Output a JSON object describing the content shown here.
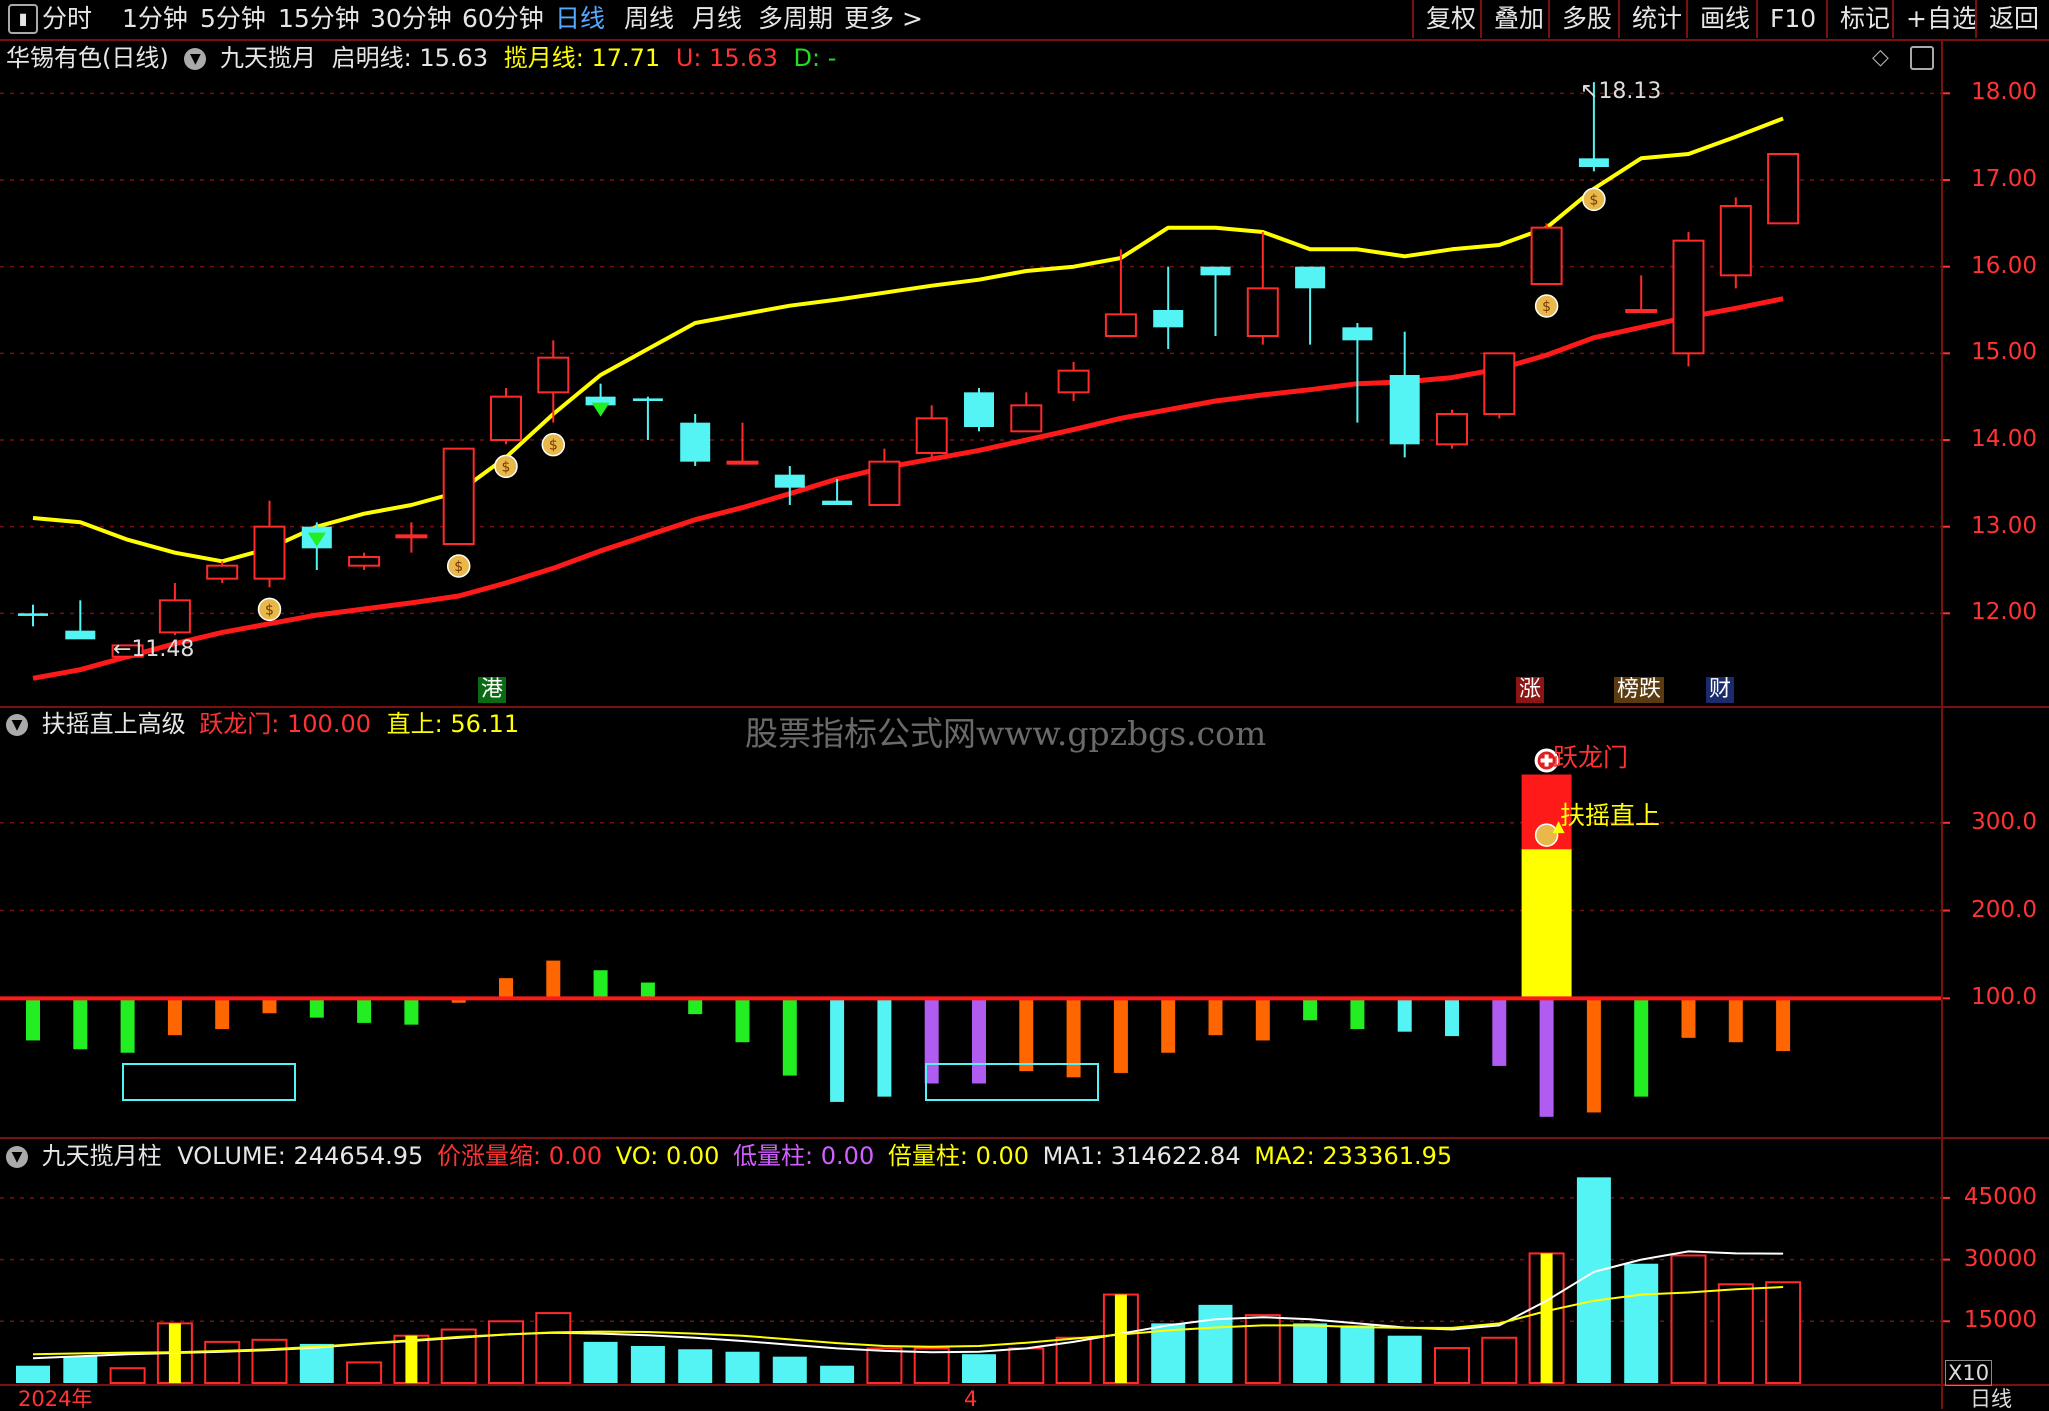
{
  "toolbar": {
    "left": [
      "分时",
      "1分钟",
      "5分钟",
      "15分钟",
      "30分钟",
      "60分钟",
      "日线",
      "周线",
      "月线",
      "多周期",
      "更多 >"
    ],
    "active": "日线",
    "right": [
      "复权",
      "叠加",
      "多股",
      "统计",
      "画线",
      "F10",
      "标记",
      "+自选",
      "返回"
    ]
  },
  "main_panel": {
    "stock_name": "华锡有色(日线)",
    "indicator_name": "九天揽月",
    "qiming_label": "启明线:",
    "qiming_value": "15.63",
    "lanyue_label": "揽月线:",
    "lanyue_value": "17.71",
    "u_label": "U:",
    "u_value": "15.63",
    "d_label": "D:",
    "d_value": "-",
    "high_label": "18.13",
    "low_label": "11.48",
    "yticks": [
      "18.00",
      "17.00",
      "16.00",
      "15.00",
      "14.00",
      "13.00",
      "12.00"
    ],
    "badges": [
      "港",
      "涨",
      "榜跌",
      "财"
    ]
  },
  "indicator_panel": {
    "name": "扶摇直上高级",
    "yuelongmen_label": "跃龙门:",
    "yuelongmen_value": "100.00",
    "zhishang_label": "直上:",
    "zhishang_value": "56.11",
    "watermark": "股票指标公式网www.gpzbgs.com",
    "signal_yuelongmen": "跃龙门",
    "signal_fuyao": "扶摇直上",
    "yticks": [
      "300.0",
      "200.0",
      "100.0"
    ]
  },
  "volume_panel": {
    "name": "九天揽月柱",
    "volume_label": "VOLUME:",
    "volume_value": "244654.95",
    "jzls_label": "价涨量缩:",
    "jzls_value": "0.00",
    "vo_label": "VO:",
    "vo_value": "0.00",
    "dlz_label": "低量柱:",
    "dlz_value": "0.00",
    "blz_label": "倍量柱:",
    "blz_value": "0.00",
    "ma1_label": "MA1:",
    "ma1_value": "314622.84",
    "ma2_label": "MA2:",
    "ma2_value": "233361.95",
    "yticks": [
      "45000",
      "30000",
      "15000"
    ],
    "unit": "X10"
  },
  "bottom_axis": {
    "year_label": "2024年",
    "month_label": "4",
    "period_label": "日线"
  },
  "colors": {
    "up": "#ff2a2a",
    "down": "#54f4f4",
    "yellow": "#ffff00",
    "green": "#22ee22",
    "purple": "#b05cf0",
    "orange": "#ff6600",
    "grid": "#7a1010"
  },
  "chart_data": [
    {
      "type": "candlestick",
      "ylim": [
        11.0,
        18.5
      ],
      "candles": [
        {
          "o": 12.0,
          "h": 12.1,
          "l": 11.85,
          "c": 11.97
        },
        {
          "o": 11.8,
          "h": 12.15,
          "l": 11.75,
          "c": 11.7
        },
        {
          "o": 11.5,
          "h": 11.6,
          "l": 11.48,
          "c": 11.63
        },
        {
          "o": 11.78,
          "h": 12.35,
          "l": 11.75,
          "c": 12.15
        },
        {
          "o": 12.4,
          "h": 12.6,
          "l": 12.35,
          "c": 12.55
        },
        {
          "o": 12.4,
          "h": 13.3,
          "l": 12.3,
          "c": 13.0
        },
        {
          "o": 13.0,
          "h": 13.05,
          "l": 12.5,
          "c": 12.75
        },
        {
          "o": 12.55,
          "h": 12.7,
          "l": 12.5,
          "c": 12.65
        },
        {
          "o": 12.9,
          "h": 13.05,
          "l": 12.7,
          "c": 12.9
        },
        {
          "o": 12.8,
          "h": 13.9,
          "l": 12.8,
          "c": 13.9
        },
        {
          "o": 14.0,
          "h": 14.6,
          "l": 13.95,
          "c": 14.5
        },
        {
          "o": 14.55,
          "h": 15.15,
          "l": 14.2,
          "c": 14.95
        },
        {
          "o": 14.5,
          "h": 14.65,
          "l": 14.3,
          "c": 14.4
        },
        {
          "o": 14.48,
          "h": 14.5,
          "l": 14.0,
          "c": 14.45
        },
        {
          "o": 14.2,
          "h": 14.3,
          "l": 13.7,
          "c": 13.75
        },
        {
          "o": 13.75,
          "h": 14.2,
          "l": 13.72,
          "c": 13.75
        },
        {
          "o": 13.6,
          "h": 13.7,
          "l": 13.25,
          "c": 13.45
        },
        {
          "o": 13.3,
          "h": 13.55,
          "l": 13.25,
          "c": 13.25
        },
        {
          "o": 13.25,
          "h": 13.9,
          "l": 13.25,
          "c": 13.75
        },
        {
          "o": 13.85,
          "h": 14.4,
          "l": 13.8,
          "c": 14.25
        },
        {
          "o": 14.55,
          "h": 14.6,
          "l": 14.1,
          "c": 14.15
        },
        {
          "o": 14.1,
          "h": 14.55,
          "l": 14.1,
          "c": 14.4
        },
        {
          "o": 14.55,
          "h": 14.9,
          "l": 14.45,
          "c": 14.8
        },
        {
          "o": 15.2,
          "h": 16.2,
          "l": 15.2,
          "c": 15.45
        },
        {
          "o": 15.5,
          "h": 16.0,
          "l": 15.05,
          "c": 15.3
        },
        {
          "o": 16.0,
          "h": 16.0,
          "l": 15.2,
          "c": 15.9
        },
        {
          "o": 15.2,
          "h": 16.4,
          "l": 15.1,
          "c": 15.75
        },
        {
          "o": 16.0,
          "h": 16.0,
          "l": 15.1,
          "c": 15.75
        },
        {
          "o": 15.3,
          "h": 15.35,
          "l": 14.2,
          "c": 15.15
        },
        {
          "o": 14.75,
          "h": 15.25,
          "l": 13.8,
          "c": 13.95
        },
        {
          "o": 13.95,
          "h": 14.35,
          "l": 13.9,
          "c": 14.3
        },
        {
          "o": 14.3,
          "h": 15.0,
          "l": 14.25,
          "c": 15.0
        },
        {
          "o": 15.8,
          "h": 16.5,
          "l": 15.8,
          "c": 16.45
        },
        {
          "o": 17.25,
          "h": 18.13,
          "l": 17.1,
          "c": 17.15
        },
        {
          "o": 15.5,
          "h": 15.9,
          "l": 15.5,
          "c": 15.5
        },
        {
          "o": 15.0,
          "h": 16.4,
          "l": 14.85,
          "c": 16.3
        },
        {
          "o": 15.9,
          "h": 16.8,
          "l": 15.75,
          "c": 16.7
        },
        {
          "o": 16.5,
          "h": 17.3,
          "l": 16.5,
          "c": 17.3
        }
      ],
      "lanyue_line": [
        13.1,
        13.05,
        12.85,
        12.7,
        12.6,
        12.75,
        13.0,
        13.15,
        13.25,
        13.4,
        13.8,
        14.3,
        14.75,
        15.05,
        15.35,
        15.45,
        15.55,
        15.62,
        15.7,
        15.78,
        15.85,
        15.95,
        16.0,
        16.1,
        16.45,
        16.45,
        16.4,
        16.2,
        16.2,
        16.12,
        16.2,
        16.25,
        16.45,
        16.9,
        17.25,
        17.3,
        17.5,
        17.71
      ],
      "qiming_line": [
        11.25,
        11.35,
        11.5,
        11.65,
        11.78,
        11.88,
        11.98,
        12.05,
        12.12,
        12.2,
        12.35,
        12.52,
        12.72,
        12.9,
        13.08,
        13.22,
        13.38,
        13.55,
        13.68,
        13.78,
        13.88,
        14.0,
        14.12,
        14.25,
        14.35,
        14.45,
        14.52,
        14.58,
        14.65,
        14.67,
        14.72,
        14.82,
        14.98,
        15.18,
        15.3,
        15.42,
        15.52,
        15.63
      ],
      "money_markers": [
        5,
        9,
        10,
        11,
        32,
        33
      ],
      "green_arrows": [
        6,
        12
      ]
    },
    {
      "type": "bar",
      "ylim": [
        -50,
        400
      ],
      "baseline": 100,
      "values": [
        52,
        42,
        38,
        58,
        65,
        83,
        78,
        72,
        70,
        95,
        123,
        143,
        132,
        118,
        82,
        50,
        12,
        -18,
        -12,
        3,
        3,
        17,
        10,
        15,
        38,
        58,
        52,
        75,
        65,
        62,
        57,
        23,
        -35,
        -30,
        -12,
        55,
        50,
        40
      ],
      "colors": [
        "green",
        "green",
        "green",
        "orange",
        "orange",
        "orange",
        "green",
        "green",
        "green",
        "orange",
        "orange",
        "orange",
        "green",
        "green",
        "green",
        "green",
        "green",
        "cyan",
        "cyan",
        "purple",
        "purple",
        "orange",
        "orange",
        "orange",
        "orange",
        "orange",
        "orange",
        "green",
        "green",
        "cyan",
        "cyan",
        "purple",
        "purple",
        "orange",
        "green",
        "orange",
        "orange",
        "orange"
      ],
      "signal_bar": {
        "index": 32,
        "yellow_top": 270,
        "red_top": 355
      }
    },
    {
      "type": "bar",
      "ylim": [
        0,
        53000
      ],
      "values": [
        4200,
        6500,
        3600,
        14500,
        10000,
        10500,
        9500,
        5000,
        11500,
        13000,
        15000,
        17000,
        10000,
        9000,
        8200,
        7600,
        6400,
        4200,
        8400,
        8400,
        7000,
        8400,
        11000,
        21500,
        14500,
        19000,
        16500,
        14500,
        14000,
        11500,
        8500,
        11000,
        31500,
        50000,
        29000,
        31000,
        24000,
        24500
      ],
      "kinds": [
        "down",
        "down",
        "up",
        "yellow",
        "up",
        "up",
        "down",
        "up",
        "yellow",
        "up",
        "up",
        "up",
        "down",
        "down",
        "down",
        "down",
        "down",
        "down",
        "up",
        "up",
        "down",
        "up",
        "up",
        "yellow",
        "down",
        "down",
        "up",
        "down",
        "down",
        "down",
        "up",
        "up",
        "yellow",
        "down",
        "down",
        "up",
        "up",
        "up"
      ],
      "ma1": [
        6000,
        6500,
        7000,
        7300,
        7600,
        8000,
        8600,
        9500,
        10200,
        11000,
        11800,
        12200,
        12000,
        11600,
        11000,
        10200,
        9300,
        8400,
        7800,
        7500,
        7600,
        8400,
        10000,
        12000,
        14000,
        15500,
        16000,
        15500,
        14500,
        13500,
        13000,
        14000,
        20000,
        27000,
        30000,
        32000,
        31500,
        31462
      ],
      "ma2": [
        7000,
        7200,
        7400,
        7500,
        7800,
        8200,
        8800,
        9600,
        10400,
        11200,
        11800,
        12300,
        12500,
        12400,
        12000,
        11500,
        10600,
        9700,
        9000,
        8800,
        9000,
        9800,
        10800,
        11800,
        12800,
        13500,
        14000,
        14000,
        13600,
        13400,
        13400,
        14500,
        17500,
        20000,
        21500,
        22000,
        22800,
        23336
      ]
    }
  ]
}
